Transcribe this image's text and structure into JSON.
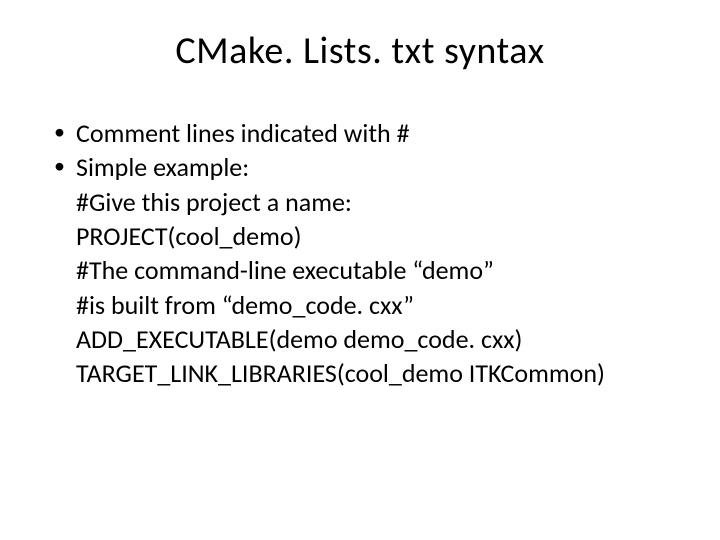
{
  "title": "CMake. Lists. txt syntax",
  "bullets": [
    "Comment lines indicated with #",
    "Simple example:"
  ],
  "code_lines": [
    "#Give this project a name:",
    "PROJECT(cool_demo)",
    "#The command-line executable “demo”",
    "#is built from “demo_code. cxx”",
    "ADD_EXECUTABLE(demo demo_code. cxx)",
    "TARGET_LINK_LIBRARIES(cool_demo ITKCommon)"
  ]
}
